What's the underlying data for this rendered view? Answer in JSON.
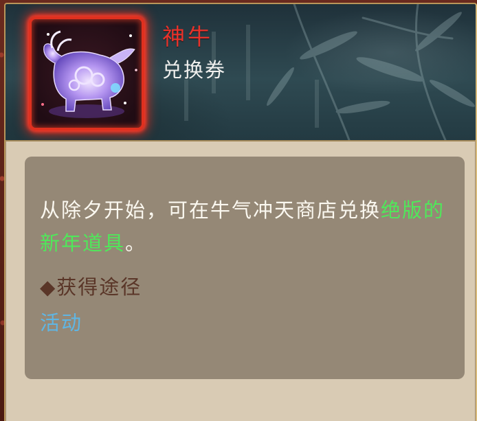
{
  "item": {
    "name": "神牛",
    "type": "兑换券",
    "icon": "golden-ox-figurine-icon",
    "name_color": "#e8322a",
    "frame_color": "#e0301f"
  },
  "description": {
    "text_before": "从除夕开始，可在牛气冲天商店兑换",
    "highlight": "绝版的新年道具",
    "text_after": "。",
    "highlight_color": "#4fe85a"
  },
  "source": {
    "title": "◆获得途径",
    "link": "活动",
    "link_color": "#5fb6e4"
  }
}
